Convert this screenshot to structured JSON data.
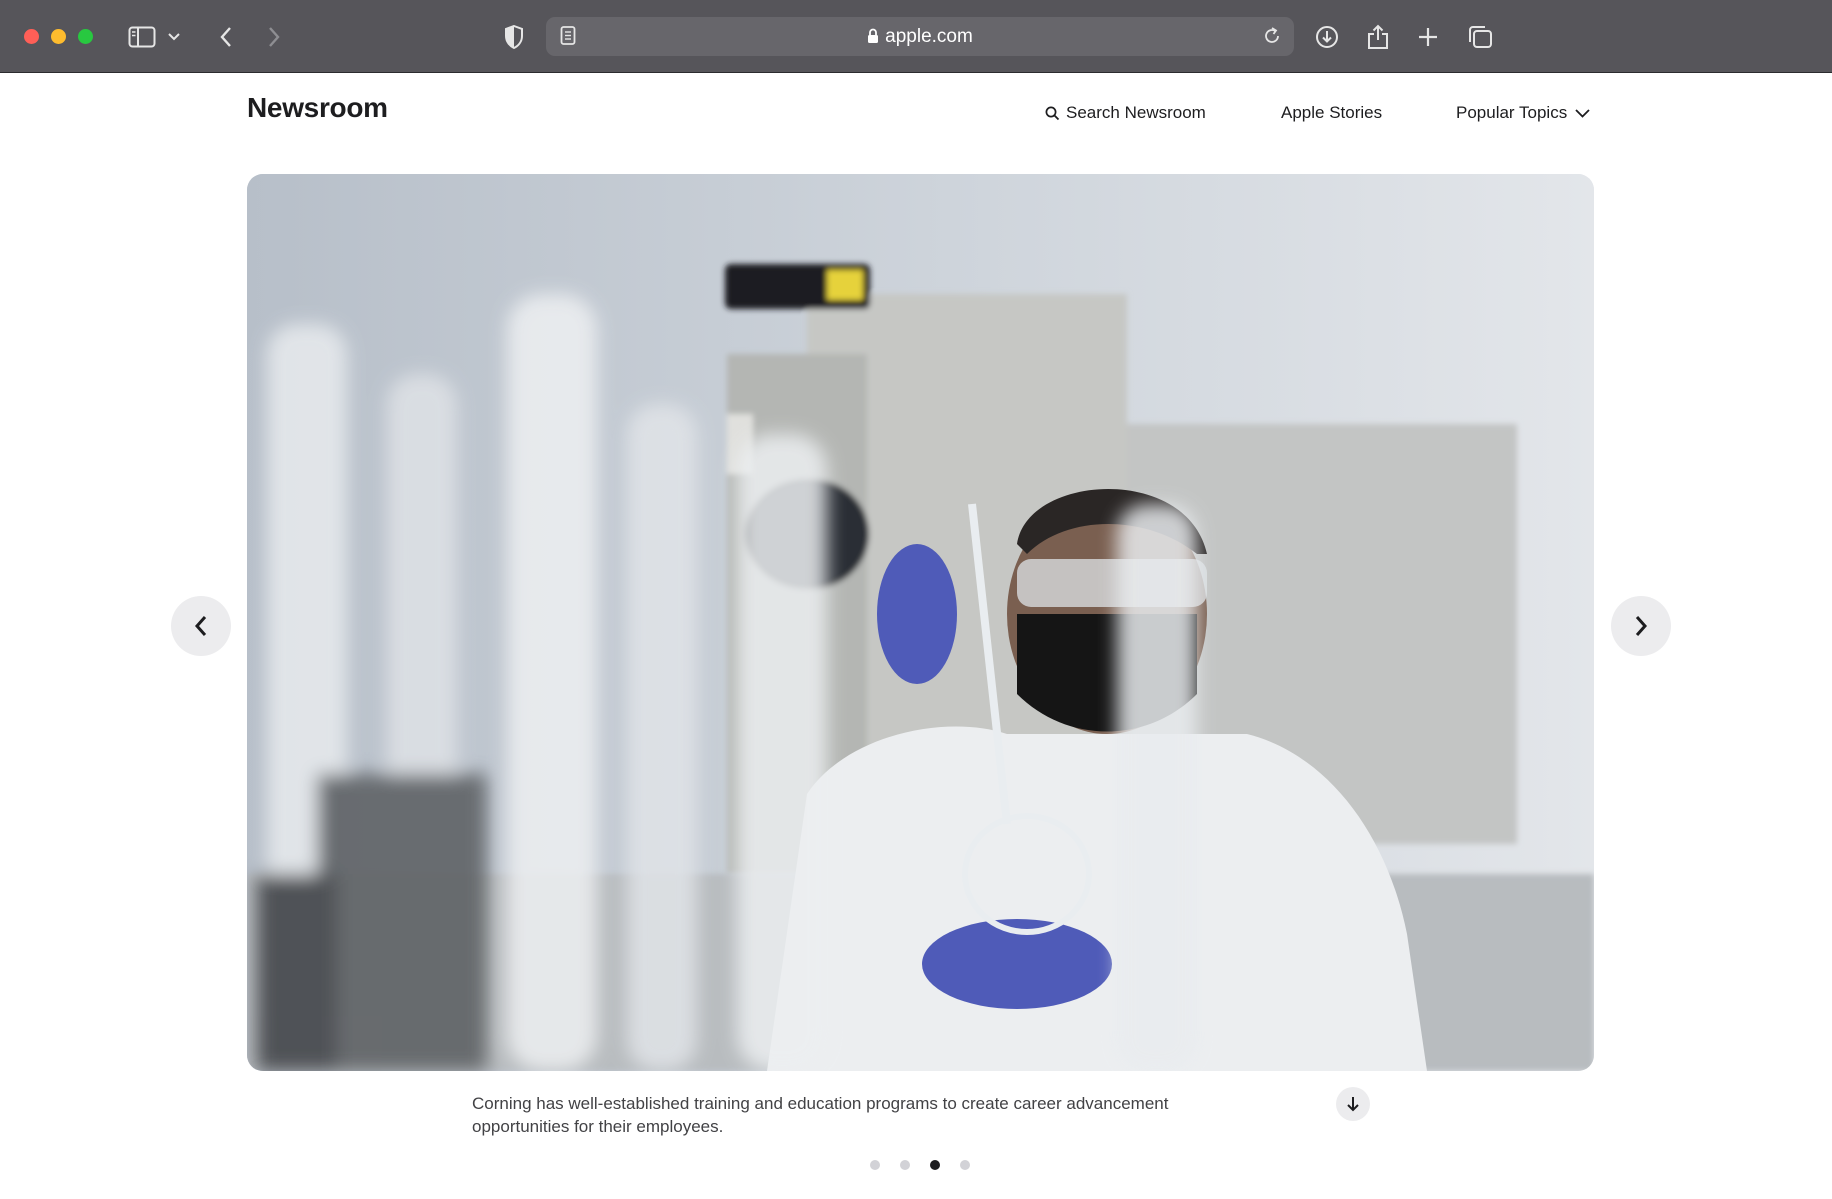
{
  "browser": {
    "url": "apple.com",
    "icons": [
      "sidebar-icon",
      "chevron-down-icon",
      "back-icon",
      "forward-icon",
      "shield-icon",
      "reader-icon",
      "lock-icon",
      "reload-icon",
      "download-icon",
      "share-icon",
      "plus-icon",
      "tabs-icon"
    ]
  },
  "header": {
    "brand": "Newsroom",
    "nav": {
      "search_label": "Search Newsroom",
      "stories_label": "Apple Stories",
      "topics_label": "Popular Topics"
    }
  },
  "gallery": {
    "image_alt": "Corning lab scientist examining a glass flask",
    "caption": "Corning has well-established training and education programs to create career advancement opportunities for their employees.",
    "slide_count": 4,
    "active_slide_index": 2
  }
}
